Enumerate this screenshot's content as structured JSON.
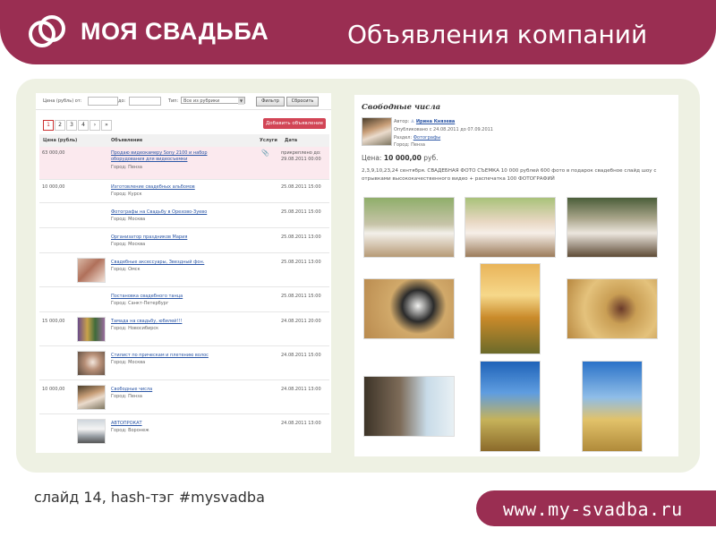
{
  "header": {
    "logo_text": "МОЯ СВАДЬБА",
    "title": "Объявления компаний",
    "logo_icon": "rings-icon",
    "brand_color": "#9a2e52"
  },
  "filter": {
    "price_label": "Цена (рубль) от:",
    "to_label": "до:",
    "type_label": "Тип:",
    "type_select_value": "Все из рубрики",
    "filter_button": "Фильтр",
    "reset_button": "Сбросить"
  },
  "pager": {
    "pages": [
      "1",
      "2",
      "3",
      "4",
      "›",
      "»"
    ],
    "active": "1"
  },
  "add_button": "Добавить объявление",
  "table": {
    "headers": {
      "price": "Цена (рубль)",
      "ad": "Объявление",
      "services": "Услуги",
      "date": "Дата"
    },
    "rows": [
      {
        "price": "63 000,00",
        "title": "Продаю видеокамеру Sony 2100 и набор оборудования для видеосъемки",
        "city": "Город: Пенза",
        "date": "прикреплено до: 29.08.2011 00:00"
      },
      {
        "price": "10 000,00",
        "title": "Изготовление свадебных альбомов",
        "city": "Город: Курск",
        "date": "25.08.2011 15:00"
      },
      {
        "price": "",
        "title": "Фотографы на Свадьбу в Орехово-Зуево",
        "city": "Город: Москва",
        "date": "25.08.2011 15:00"
      },
      {
        "price": "",
        "title": "Организатор праздников Мария",
        "city": "Город: Москва",
        "date": "25.08.2011 13:00"
      },
      {
        "price": "",
        "title": "Свадебные аксессуары, Звездный фон.",
        "city": "Город: Омск",
        "date": "25.08.2011 13:00"
      },
      {
        "price": "",
        "title": "Постановка свадебного танца",
        "city": "Город: Санкт-Петербург",
        "date": "25.08.2011 15:00"
      },
      {
        "price": "15 000,00",
        "title": "Тамада на свадьбу, юбилей!!!",
        "city": "Город: Новосибирск",
        "date": "24.08.2011 20:00"
      },
      {
        "price": "",
        "title": "Стилист по прическам и плетению волос",
        "city": "Город: Москва",
        "date": "24.08.2011 15:00"
      },
      {
        "price": "10 000,00",
        "title": "Свободные числа",
        "city": "Город: Пенза",
        "date": "24.08.2011 13:00"
      },
      {
        "price": "",
        "title": "АВТОПРОКАТ",
        "city": "Город: Воронеж",
        "date": "24.08.2011 13:00"
      }
    ]
  },
  "ad": {
    "title": "Свободные числа",
    "author_label": "Автор:",
    "author": "Ирина Князева",
    "published": "Опубликовано с 24.08.2011 до 07.09.2011",
    "section_label": "Раздел:",
    "section": "Фотографы",
    "city": "Город: Пенза",
    "price_label": "Цена:",
    "price": "10 000,00",
    "currency": "руб.",
    "description": "2,3,9,10,23,24 сентября. СВАДЕБНАЯ ФОТО СЪЕМКА 10 000 рублей 600 фото в подарок свадебное слайд шоу с отрывками высококачественного видео + распечатка 100 ФОТОГРАФИЙ"
  },
  "footer": {
    "slide_note": "слайд 14, hash-тэг #mysvadba",
    "url": "www.my-svadba.ru"
  }
}
